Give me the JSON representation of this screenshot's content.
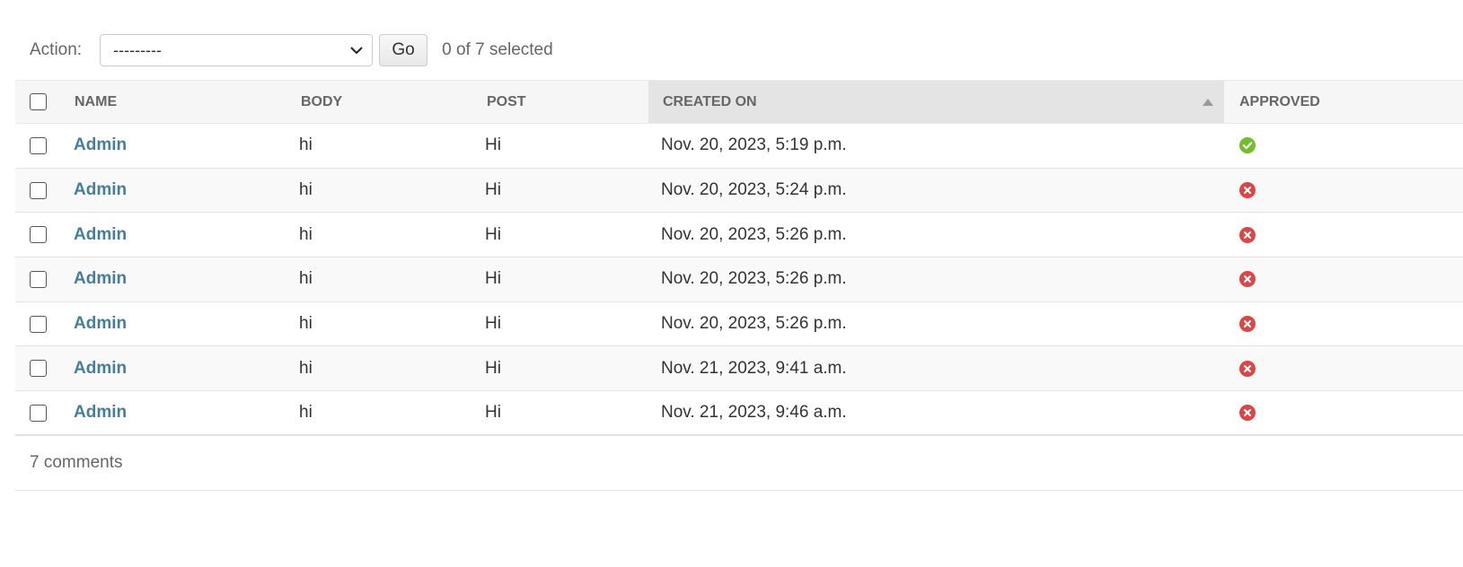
{
  "actions": {
    "label": "Action:",
    "select_value": "---------",
    "go_label": "Go",
    "selected_text": "0 of 7 selected"
  },
  "table": {
    "headers": {
      "name": "NAME",
      "body": "BODY",
      "post": "POST",
      "created_on": "CREATED ON",
      "approved": "APPROVED"
    },
    "sorted_column": "created_on",
    "sort_direction": "ascending",
    "rows": [
      {
        "name": "Admin",
        "body": "hi",
        "post": "Hi",
        "created_on": "Nov. 20, 2023, 5:19 p.m.",
        "approved": true
      },
      {
        "name": "Admin",
        "body": "hi",
        "post": "Hi",
        "created_on": "Nov. 20, 2023, 5:24 p.m.",
        "approved": false
      },
      {
        "name": "Admin",
        "body": "hi",
        "post": "Hi",
        "created_on": "Nov. 20, 2023, 5:26 p.m.",
        "approved": false
      },
      {
        "name": "Admin",
        "body": "hi",
        "post": "Hi",
        "created_on": "Nov. 20, 2023, 5:26 p.m.",
        "approved": false
      },
      {
        "name": "Admin",
        "body": "hi",
        "post": "Hi",
        "created_on": "Nov. 20, 2023, 5:26 p.m.",
        "approved": false
      },
      {
        "name": "Admin",
        "body": "hi",
        "post": "Hi",
        "created_on": "Nov. 21, 2023, 9:41 a.m.",
        "approved": false
      },
      {
        "name": "Admin",
        "body": "hi",
        "post": "Hi",
        "created_on": "Nov. 21, 2023, 9:46 a.m.",
        "approved": false
      }
    ]
  },
  "paginator": {
    "text": "7 comments"
  },
  "colors": {
    "link": "#447e9b",
    "approved_yes": "#70bf2b",
    "approved_no": "#dd4646",
    "header_bg": "#f6f6f6",
    "sorted_header_bg": "#e4e4e4"
  },
  "icons": {
    "approved_yes": "check-circle-icon",
    "approved_no": "x-circle-icon"
  }
}
